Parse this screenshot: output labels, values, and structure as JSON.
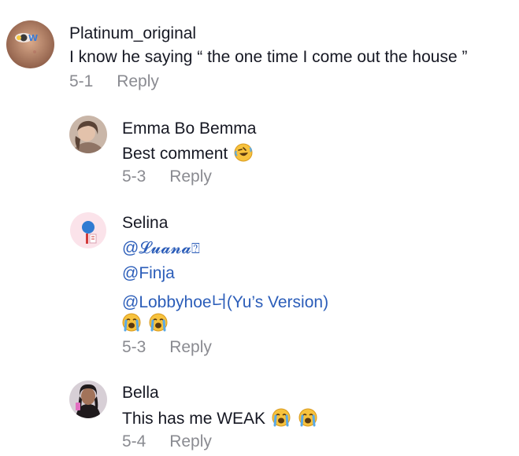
{
  "comments": [
    {
      "username": "Platinum_original",
      "text": "I know he saying “ the one time I come out the house ”",
      "date": "5-1",
      "reply_label": "Reply",
      "avatar_icon": "avatar-eye-w"
    },
    {
      "username": "Emma Bo Bemma",
      "text": "Best comment",
      "emoji": "rolling-laughing-face",
      "date": "5-3",
      "reply_label": "Reply",
      "avatar_icon": "avatar-photo"
    },
    {
      "username": "Selina",
      "mentions": [
        "@𝓛𝓾𝓪𝓷𝓪",
        "@Finja",
        "@Lobbyhoe너(Yu’s Version)"
      ],
      "mention_trailing_glyph": "⍰",
      "emoji": "loudly-crying-face",
      "date": "5-3",
      "reply_label": "Reply",
      "avatar_icon": "avatar-cartoon"
    },
    {
      "username": "Bella",
      "text": "This has me WEAK",
      "emoji": "loudly-crying-face",
      "date": "5-4",
      "reply_label": "Reply",
      "avatar_icon": "avatar-photo"
    }
  ],
  "colors": {
    "text": "#161823",
    "meta": "#8a8b91",
    "mention": "#2b5db9"
  }
}
